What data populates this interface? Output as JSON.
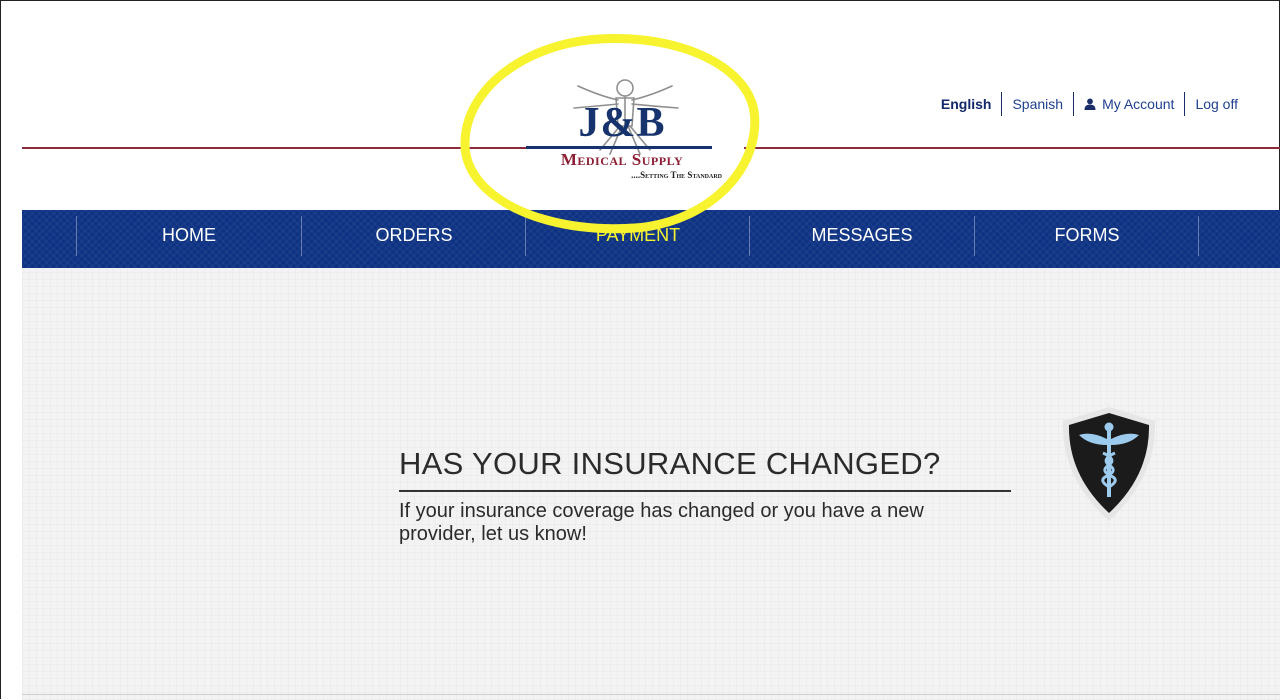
{
  "logo": {
    "initials": "J&B",
    "name": "Medical Supply",
    "tagline": "....Setting The Standard"
  },
  "top_links": {
    "english": "English",
    "spanish": "Spanish",
    "my_account": "My Account",
    "logoff": "Log off",
    "icons": {
      "account": "user-icon"
    }
  },
  "nav": {
    "items": [
      {
        "label": "HOME"
      },
      {
        "label": "ORDERS"
      },
      {
        "label": "PAYMENT"
      },
      {
        "label": "MESSAGES"
      },
      {
        "label": "FORMS"
      }
    ],
    "current": "PAYMENT"
  },
  "promo": {
    "title": "HAS YOUR INSURANCE CHANGED?",
    "text": "If your insurance coverage has changed or you have a new provider, let us know!",
    "icon": "caduceus-shield-icon"
  },
  "colors": {
    "nav_bg": "#0d3283",
    "nav_current": "#f7f32e",
    "brand_blue": "#17336e",
    "brand_red": "#8c1f35",
    "highlight": "#f7f32e"
  }
}
